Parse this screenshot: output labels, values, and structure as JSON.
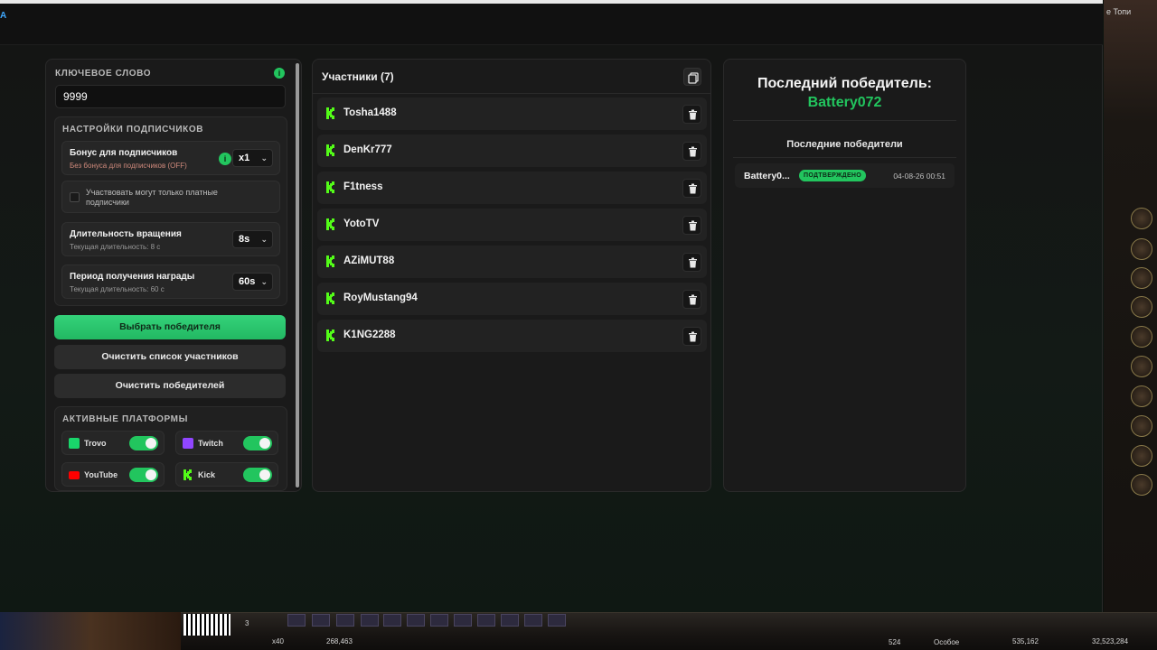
{
  "app": {
    "title_fragment": "A"
  },
  "settings": {
    "keyword_title": "КЛЮЧЕВОЕ СЛОВО",
    "keyword_value": "9999",
    "info_glyph": "i",
    "subs_title": "НАСТРОЙКИ ПОДПИСЧИКОВ",
    "bonus_label": "Бонус для подписчиков",
    "bonus_hint": "Без бонуса для подписчиков (OFF)",
    "bonus_value": "x1",
    "paid_only_label": "Участвовать могут только платные подписчики",
    "duration_label": "Длительность вращения",
    "duration_hint": "Текущая длительность: 8 с",
    "duration_value": "8s",
    "period_label": "Период получения награды",
    "period_hint": "Текущая длительность: 60 с",
    "period_value": "60s",
    "chevron": "⌄"
  },
  "buttons": {
    "pick_winner": "Выбрать победителя",
    "clear_participants": "Очистить список участников",
    "clear_winners": "Очистить победителей"
  },
  "platforms": {
    "title": "АКТИВНЫЕ ПЛАТФОРМЫ",
    "items": [
      {
        "label": "Trovo",
        "color": "#19d66b",
        "enabled": true
      },
      {
        "label": "Twitch",
        "color": "#9146ff",
        "enabled": true
      },
      {
        "label": "YouTube",
        "color": "#ff0000",
        "enabled": true
      },
      {
        "label": "Kick",
        "color": "#53fc18",
        "enabled": true
      }
    ]
  },
  "participants": {
    "title": "Участники (7)",
    "items": [
      {
        "name": "Tosha1488"
      },
      {
        "name": "DenKr777"
      },
      {
        "name": "F1tness"
      },
      {
        "name": "YotoTV"
      },
      {
        "name": "AZiMUT88"
      },
      {
        "name": "RoyMustang94"
      },
      {
        "name": "K1NG2288"
      }
    ]
  },
  "winners": {
    "last_label": "Последний победитель:",
    "last_name": "Battery072",
    "recent_title": "Последние победители",
    "recent": [
      {
        "name": "Battery0...",
        "status": "ПОДТВЕРЖДЕНО",
        "date": "04-08-26 00:51"
      }
    ]
  },
  "game_ui": {
    "top_right_text": "е Топи",
    "bottom_values": [
      "3",
      "x40",
      "268,463",
      "524",
      "Особое",
      "535,162",
      "32,523,284"
    ]
  },
  "colors": {
    "accent_green": "#22c55e",
    "panel_bg": "#1a1a1a"
  }
}
